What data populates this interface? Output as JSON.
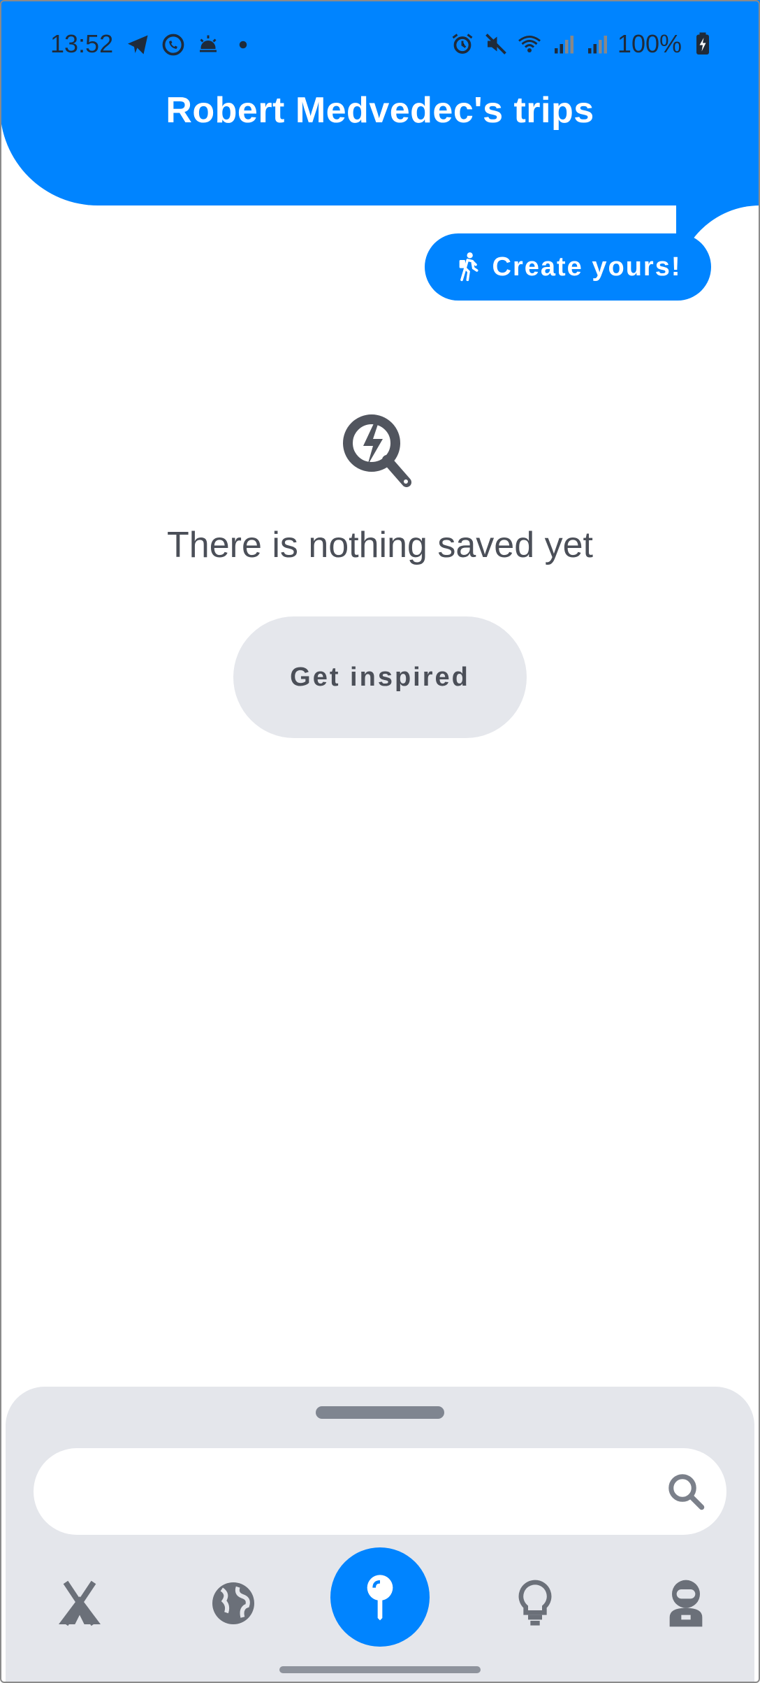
{
  "status_bar": {
    "time": "13:52",
    "battery": "100%"
  },
  "header": {
    "title": "Robert Medvedec's trips"
  },
  "actions": {
    "create_label": "Create yours!",
    "inspire_label": "Get inspired"
  },
  "empty_state": {
    "message": "There is nothing saved yet"
  },
  "search": {
    "placeholder": ""
  },
  "nav": {
    "items": [
      {
        "icon": "tent-icon"
      },
      {
        "icon": "globe-icon"
      },
      {
        "icon": "pin-icon",
        "active": true
      },
      {
        "icon": "lightbulb-icon"
      },
      {
        "icon": "astronaut-icon"
      }
    ]
  },
  "colors": {
    "primary": "#0084ff",
    "sheet": "#e4e6eb",
    "text_dark": "#4b4f58"
  }
}
